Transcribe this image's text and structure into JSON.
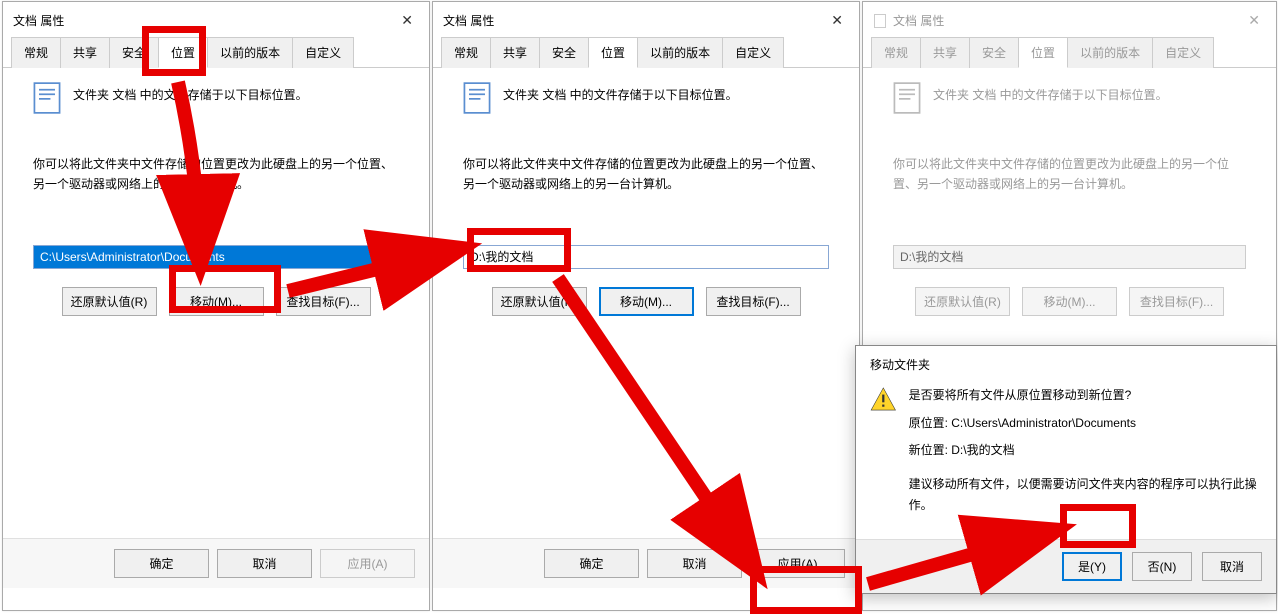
{
  "dialogs": [
    {
      "title": "文档 属性",
      "path": "C:\\Users\\Administrator\\Documents",
      "apply_enabled": false
    },
    {
      "title": "文档 属性",
      "path": "D:\\我的文档",
      "apply_enabled": true
    },
    {
      "title": "文档 属性",
      "path": "D:\\我的文档",
      "dim": true
    }
  ],
  "tabs": [
    "常规",
    "共享",
    "安全",
    "位置",
    "以前的版本",
    "自定义"
  ],
  "active_tab_index": 3,
  "desc": "文件夹 文档 中的文件存储于以下目标位置。",
  "note": "你可以将此文件夹中文件存储的位置更改为此硬盘上的另一个位置、另一个驱动器或网络上的另一台计算机。",
  "note_dialog1_line1": "你可以将此文件夹中文件",
  "note_dialog1_cont": "储的位置更改为此硬盘上的另一个位置、另一个驱动器或网",
  "note_dialog1_end": "的另一台计算机。",
  "buttons": {
    "restore": "还原默认值(R)",
    "move": "移动(M)...",
    "find": "查找目标(F)...",
    "ok": "确定",
    "cancel": "取消",
    "apply": "应用(A)"
  },
  "confirm": {
    "title": "移动文件夹",
    "question": "是否要将所有文件从原位置移动到新位置?",
    "old_label": "原位置: C:\\Users\\Administrator\\Documents",
    "new_label": "新位置: D:\\我的文档",
    "suggest": "建议移动所有文件，以便需要访问文件夹内容的程序可以执行此操作。",
    "yes": "是(Y)",
    "no": "否(N)",
    "cancel": "取消"
  }
}
